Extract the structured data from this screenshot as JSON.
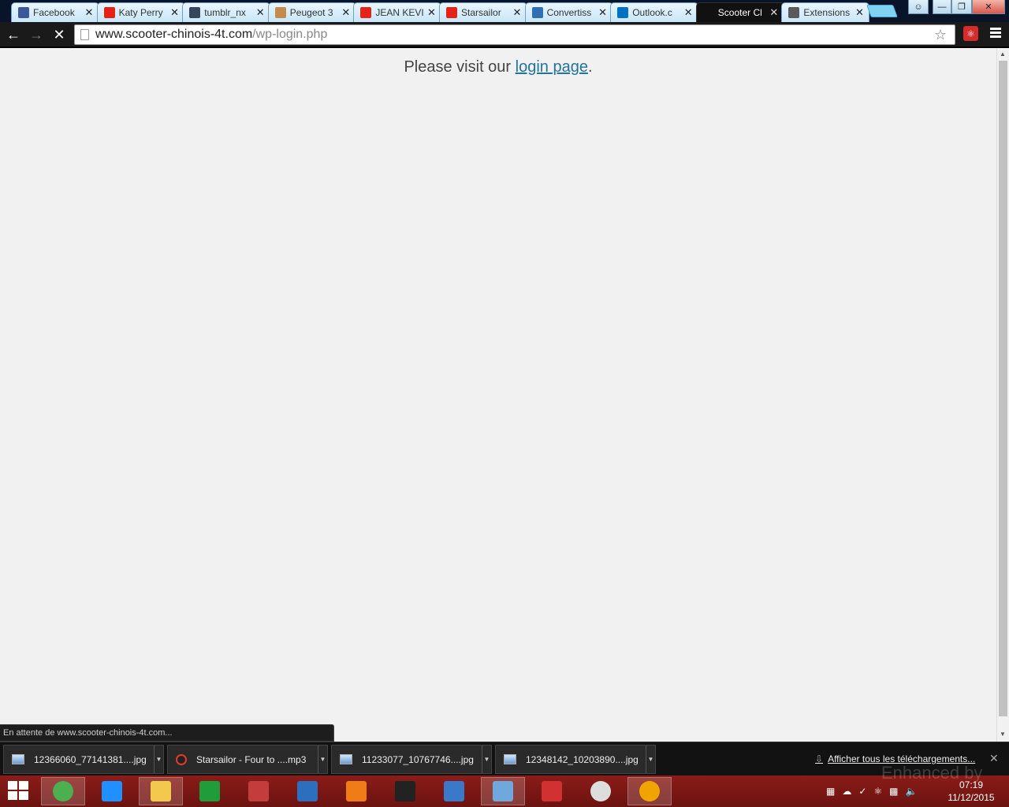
{
  "browser": {
    "tabs": [
      {
        "title": "Facebook",
        "icon": "facebook-icon",
        "icon_color": "#3b5998",
        "active": false
      },
      {
        "title": "Katy Perry",
        "icon": "youtube-icon",
        "icon_color": "#e62117",
        "active": false
      },
      {
        "title": "tumblr_nx",
        "icon": "tumblr-icon",
        "icon_color": "#36465d",
        "active": false
      },
      {
        "title": "Peugeot 3",
        "icon": "box-icon",
        "icon_color": "#c58b4e",
        "active": false
      },
      {
        "title": "JEAN KEVI",
        "icon": "youtube-icon",
        "icon_color": "#e62117",
        "active": false
      },
      {
        "title": "Starsailor",
        "icon": "youtube-icon",
        "icon_color": "#e62117",
        "active": false
      },
      {
        "title": "Convertiss",
        "icon": "ytmp3-icon",
        "icon_color": "#2f6fb6",
        "active": false
      },
      {
        "title": "Outlook.c",
        "icon": "outlook-icon",
        "icon_color": "#0072c6",
        "active": false
      },
      {
        "title": "Scooter Cl",
        "icon": "loading-icon",
        "icon_color": "#111111",
        "active": true
      },
      {
        "title": "Extensions",
        "icon": "puzzle-icon",
        "icon_color": "#5a5a5a",
        "active": false
      }
    ],
    "url_host": "www.scooter-chinois-4t.com",
    "url_path": "/wp-login.php"
  },
  "page": {
    "message_before": "Please visit our ",
    "link_text": "login page",
    "message_after": "."
  },
  "status_text": "En attente de www.scooter-chinois-4t.com...",
  "downloads": {
    "items": [
      {
        "name": "12366060_77141381....jpg",
        "type": "image"
      },
      {
        "name": "Starsailor - Four to ....mp3",
        "type": "audio"
      },
      {
        "name": "11233077_10767746....jpg",
        "type": "image"
      },
      {
        "name": "12348142_10203890....jpg",
        "type": "image"
      }
    ],
    "show_all": "Afficher tous les téléchargements..."
  },
  "taskbar": {
    "apps": [
      {
        "name": "chrome-icon",
        "color": "#4caf50",
        "active": true
      },
      {
        "name": "internet-explorer-icon",
        "color": "#1e90ff",
        "active": false
      },
      {
        "name": "file-explorer-icon",
        "color": "#f2c94c",
        "active": true
      },
      {
        "name": "store-icon",
        "color": "#1f9d3a",
        "active": false
      },
      {
        "name": "snipping-tool-icon",
        "color": "#c43c3c",
        "active": false
      },
      {
        "name": "media-player-icon",
        "color": "#2d6fbf",
        "active": false
      },
      {
        "name": "game-icon",
        "color": "#f07c18",
        "active": false
      },
      {
        "name": "car-icon",
        "color": "#222222",
        "active": false
      },
      {
        "name": "notepad-icon",
        "color": "#3a79c9",
        "active": false
      },
      {
        "name": "paint-icon",
        "color": "#6fa8dc",
        "active": true
      },
      {
        "name": "pin-icon",
        "color": "#d33131",
        "active": false
      },
      {
        "name": "compass-icon",
        "color": "#dddddd",
        "active": false
      },
      {
        "name": "avast-icon",
        "color": "#f0a400",
        "active": true
      }
    ],
    "time": "07:19",
    "date": "11/12/2015"
  },
  "watermark": "Enhanced by"
}
